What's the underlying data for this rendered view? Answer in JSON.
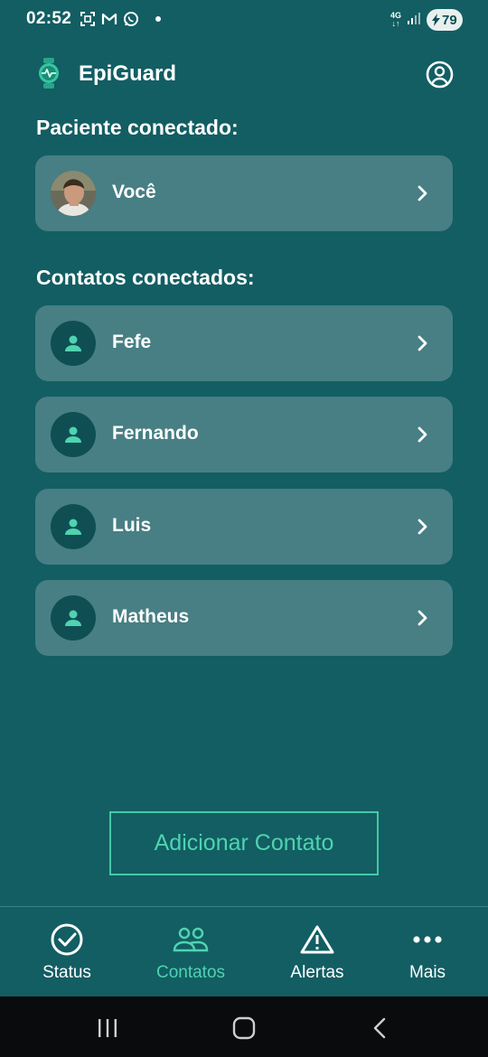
{
  "status_bar": {
    "time": "02:52",
    "network": "4G",
    "battery": "79",
    "icons": [
      "screenshot-icon",
      "gmail-icon",
      "whatsapp-icon",
      "notification-dot"
    ]
  },
  "app_bar": {
    "title": "EpiGuard",
    "logo_icon": "smartwatch-heartbeat-icon",
    "profile_icon": "account-circle-icon"
  },
  "patient_section": {
    "title": "Paciente conectado:",
    "patient": {
      "name": "Você",
      "avatar": "user-photo"
    }
  },
  "contacts_section": {
    "title": "Contatos conectados:",
    "contacts": [
      {
        "name": "Fefe"
      },
      {
        "name": "Fernando"
      },
      {
        "name": "Luis"
      },
      {
        "name": "Matheus"
      }
    ]
  },
  "add_contact_button": "Adicionar Contato",
  "bottom_nav": [
    {
      "label": "Status",
      "icon": "check-circle-icon",
      "active": false
    },
    {
      "label": "Contatos",
      "icon": "people-icon",
      "active": true
    },
    {
      "label": "Alertas",
      "icon": "warning-triangle-icon",
      "active": false
    },
    {
      "label": "Mais",
      "icon": "more-dots-icon",
      "active": false
    }
  ],
  "colors": {
    "background": "#125e63",
    "card": "#477f84",
    "accent": "#4fd3b0",
    "avatar_bg": "#0f4f53",
    "text": "#ffffff"
  }
}
